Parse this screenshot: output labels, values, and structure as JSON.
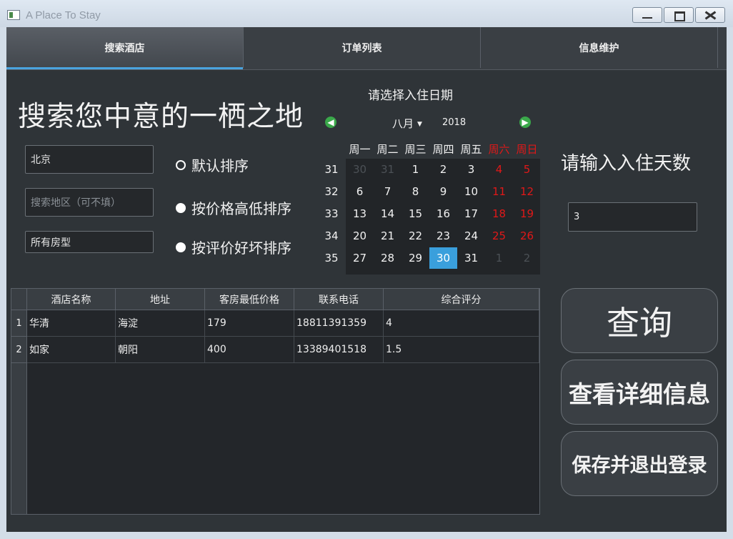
{
  "window": {
    "title": "A Place To Stay"
  },
  "tabs": [
    {
      "label": "搜索酒店"
    },
    {
      "label": "订单列表"
    },
    {
      "label": "信息维护"
    }
  ],
  "search": {
    "heading": "搜索您中意的一栖之地",
    "city_value": "北京",
    "area_placeholder": "搜索地区（可不填）",
    "room_type_value": "所有房型"
  },
  "sort_options": [
    {
      "label": "默认排序",
      "selected": false
    },
    {
      "label": "按价格高低排序",
      "selected": true
    },
    {
      "label": "按评价好坏排序",
      "selected": true
    }
  ],
  "calendar": {
    "title": "请选择入住日期",
    "month": "八月",
    "year": "2018",
    "weekdays": [
      "周一",
      "周二",
      "周三",
      "周四",
      "周五",
      "周六",
      "周日"
    ],
    "week_numbers": [
      "31",
      "32",
      "33",
      "34",
      "35"
    ],
    "weeks": [
      [
        "30",
        "31",
        "1",
        "2",
        "3",
        "4",
        "5"
      ],
      [
        "6",
        "7",
        "8",
        "9",
        "10",
        "11",
        "12"
      ],
      [
        "13",
        "14",
        "15",
        "16",
        "17",
        "18",
        "19"
      ],
      [
        "20",
        "21",
        "22",
        "23",
        "24",
        "25",
        "26"
      ],
      [
        "27",
        "28",
        "29",
        "30",
        "31",
        "1",
        "2"
      ]
    ],
    "selected": "30"
  },
  "stay_days": {
    "label": "请输入入住天数",
    "value": "3"
  },
  "table": {
    "columns": [
      "酒店名称",
      "地址",
      "客房最低价格",
      "联系电话",
      "综合评分"
    ],
    "rows": [
      {
        "index": "1",
        "cells": [
          "华清",
          "海淀",
          "179",
          "18811391359",
          "4"
        ]
      },
      {
        "index": "2",
        "cells": [
          "如家",
          "朝阳",
          "400",
          "13389401518",
          "1.5"
        ]
      }
    ]
  },
  "buttons": {
    "query": "查询",
    "detail": "查看详细信息",
    "logout": "保存并退出登录"
  }
}
